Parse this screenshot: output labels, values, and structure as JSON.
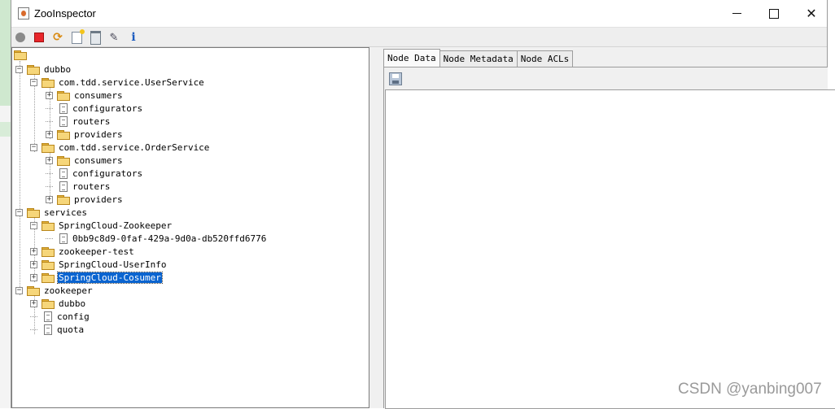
{
  "window": {
    "title": "ZooInspector"
  },
  "toolbar": {
    "icons": [
      "connect-icon",
      "disconnect-icon",
      "refresh-icon",
      "add-node-icon",
      "delete-node-icon",
      "edit-icon",
      "info-icon"
    ],
    "info_glyph": "i"
  },
  "tree": {
    "n0": "dubbo",
    "n1": "com.tdd.service.UserService",
    "n2": "consumers",
    "n3": "configurators",
    "n4": "routers",
    "n5": "providers",
    "n6": "com.tdd.service.OrderService",
    "n7": "consumers",
    "n8": "configurators",
    "n9": "routers",
    "n10": "providers",
    "n11": "services",
    "n12": "SpringCloud-Zookeeper",
    "n13": "0bb9c8d9-0faf-429a-9d0a-db520ffd6776",
    "n14": "zookeeper-test",
    "n15": "SpringCloud-UserInfo",
    "n16": "SpringCloud-Cosumer",
    "n17": "zookeeper",
    "n18": "dubbo",
    "n19": "config",
    "n20": "quota",
    "selected": "SpringCloud-Cosumer"
  },
  "tabs": {
    "node_data": "Node Data",
    "node_metadata": "Node Metadata",
    "node_acls": "Node ACLs",
    "active": "Node Data"
  },
  "watermark": "CSDN @yanbing007",
  "colors": {
    "selection": "#0a64d0",
    "folder": "#f6d67a",
    "disconnect": "#e8262b"
  }
}
